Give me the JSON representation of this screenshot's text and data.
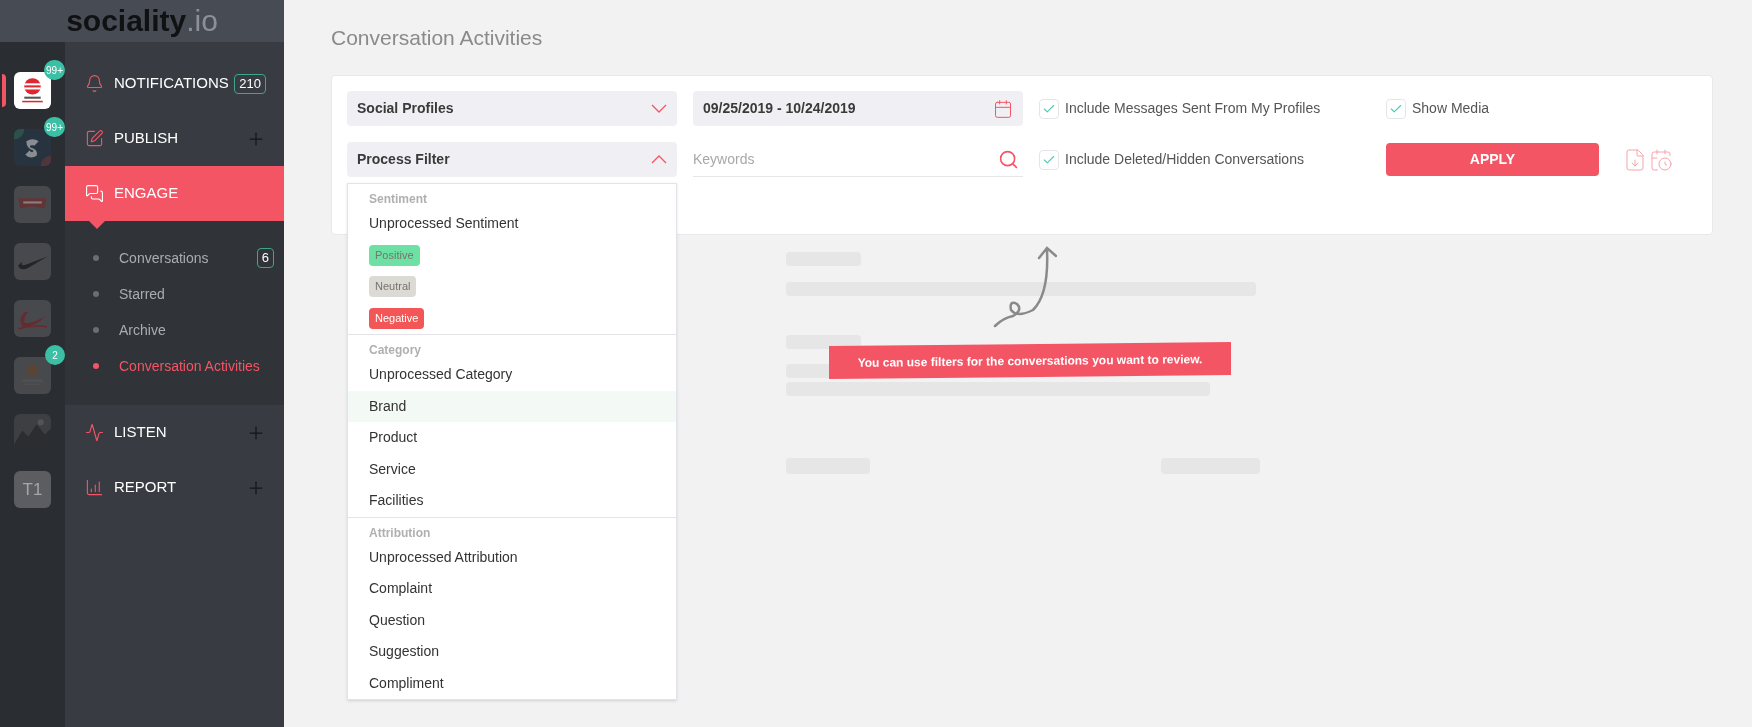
{
  "logo": {
    "name": "sociality",
    "suffix": ".io"
  },
  "accounts": [
    {
      "kind": "picture",
      "selected": true,
      "badge": "99+"
    },
    {
      "kind": "picture",
      "selected": false,
      "badge": "99+"
    },
    {
      "kind": "picture",
      "selected": false
    },
    {
      "kind": "picture",
      "selected": false
    },
    {
      "kind": "picture",
      "selected": false
    },
    {
      "kind": "picture",
      "selected": false,
      "badge": "2"
    },
    {
      "kind": "picture",
      "selected": false
    },
    {
      "kind": "initials",
      "text": "T1",
      "selected": false
    }
  ],
  "menu": [
    {
      "label": "NOTIFICATIONS",
      "count": "210",
      "expandable": false,
      "selected": false
    },
    {
      "label": "PUBLISH",
      "expandable": true,
      "selected": false
    },
    {
      "label": "ENGAGE",
      "expandable": false,
      "selected": true,
      "children": [
        {
          "label": "Conversations",
          "count": "6",
          "selected": false
        },
        {
          "label": "Starred",
          "selected": false
        },
        {
          "label": "Archive",
          "selected": false
        },
        {
          "label": "Conversation Activities",
          "selected": true
        }
      ]
    },
    {
      "label": "LISTEN",
      "expandable": true,
      "selected": false
    },
    {
      "label": "REPORT",
      "expandable": true,
      "selected": false
    }
  ],
  "page_title": "Conversation Activities",
  "filters": {
    "social_profiles": {
      "label": "Social Profiles",
      "expanded": false
    },
    "date_range": {
      "value": "09/25/2019 - 10/24/2019"
    },
    "process_filter": {
      "label": "Process Filter",
      "expanded": true
    },
    "keywords": {
      "placeholder": "Keywords"
    },
    "checkboxes": [
      {
        "label": "Include Messages Sent From My Profiles",
        "checked": true
      },
      {
        "label": "Include Deleted/Hidden Conversations",
        "checked": true
      }
    ],
    "show_media": {
      "label": "Show Media",
      "checked": true
    },
    "apply_button": "APPLY"
  },
  "process_menu": [
    {
      "heading": "Sentiment",
      "options": [
        {
          "kind": "text",
          "label": "Unprocessed Sentiment",
          "highlighted": false
        },
        {
          "kind": "tag",
          "label": "Positive",
          "color": "#6de0a4",
          "highlighted": false
        },
        {
          "kind": "tag",
          "label": "Neutral",
          "color": "#dcdad5",
          "highlighted": false
        },
        {
          "kind": "tag",
          "label": "Negative",
          "color": "#f25656",
          "highlighted": false
        }
      ]
    },
    {
      "heading": "Category",
      "options": [
        {
          "kind": "text",
          "label": "Unprocessed Category",
          "highlighted": false
        },
        {
          "kind": "text",
          "label": "Brand",
          "highlighted": true
        },
        {
          "kind": "text",
          "label": "Product",
          "highlighted": false
        },
        {
          "kind": "text",
          "label": "Service",
          "highlighted": false
        },
        {
          "kind": "text",
          "label": "Facilities",
          "highlighted": false
        }
      ]
    },
    {
      "heading": "Attribution",
      "options": [
        {
          "kind": "text",
          "label": "Unprocessed Attribution",
          "highlighted": false
        },
        {
          "kind": "text",
          "label": "Complaint",
          "highlighted": false
        },
        {
          "kind": "text",
          "label": "Question",
          "highlighted": false
        },
        {
          "kind": "text",
          "label": "Suggestion",
          "highlighted": false
        },
        {
          "kind": "text",
          "label": "Compliment",
          "highlighted": false
        }
      ]
    }
  ],
  "hint": "You can use filters for the conversations you want to review."
}
